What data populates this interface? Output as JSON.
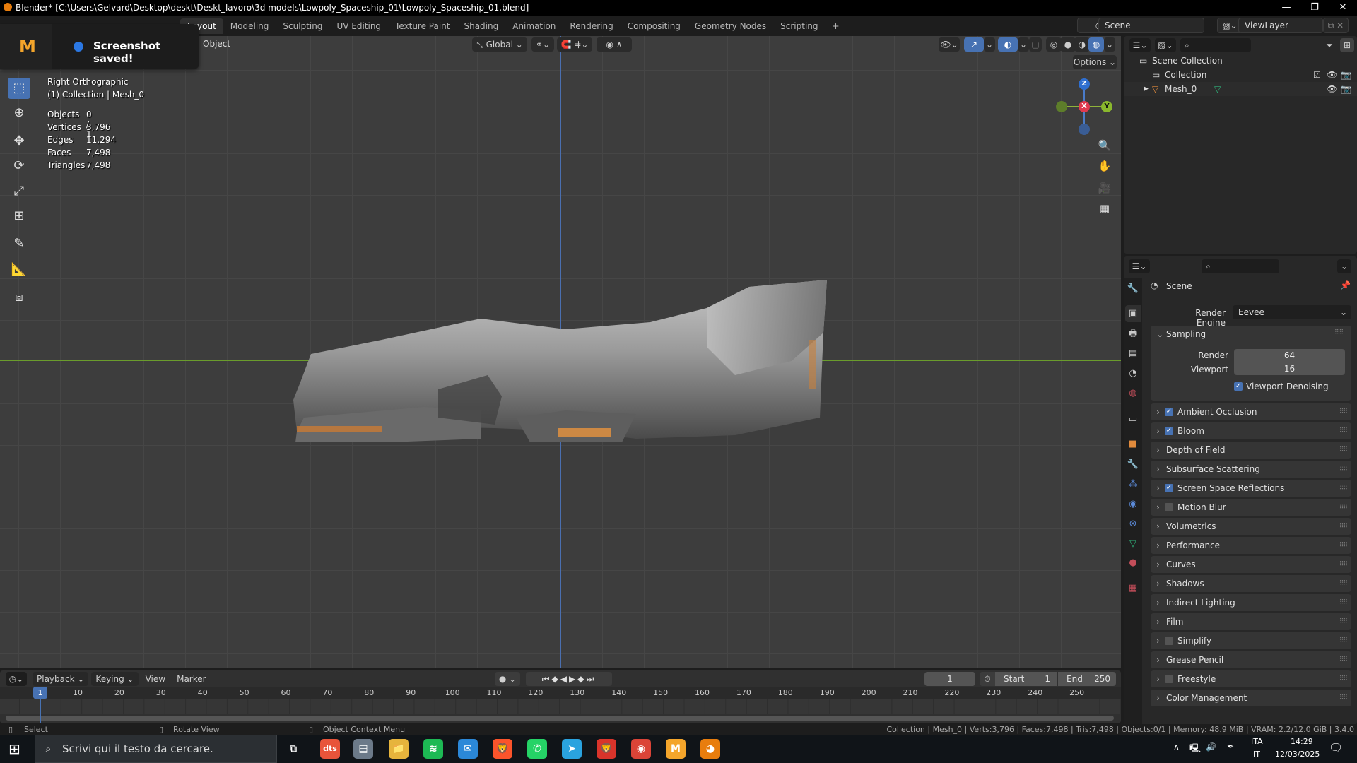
{
  "window": {
    "title": "Blender* [C:\\Users\\Gelvard\\Desktop\\deskt\\Deskt_lavoro\\3d models\\Lowpoly_Spaceship_01\\Lowpoly_Spaceship_01.blend]",
    "minimize": "—",
    "maximize": "❐",
    "close": "✕"
  },
  "workspaces": {
    "tabs": [
      "Layout",
      "Modeling",
      "Sculpting",
      "UV Editing",
      "Texture Paint",
      "Shading",
      "Animation",
      "Rendering",
      "Compositing",
      "Geometry Nodes",
      "Scripting"
    ],
    "active": "Layout",
    "add": "+"
  },
  "scene": {
    "name": "Scene",
    "view_layer": "ViewLayer"
  },
  "toast": {
    "message": "Screenshot saved!"
  },
  "viewport": {
    "menu_object": "Object",
    "orientation": "Global",
    "options": "Options ⌄",
    "view_name": "Right Orthographic",
    "context": "(1) Collection | Mesh_0",
    "stats": [
      {
        "label": "Objects",
        "value": "0 / 1"
      },
      {
        "label": "Vertices",
        "value": "3,796"
      },
      {
        "label": "Edges",
        "value": "11,294"
      },
      {
        "label": "Faces",
        "value": "7,498"
      },
      {
        "label": "Triangles",
        "value": "7,498"
      }
    ],
    "gizmo": {
      "z": "Z",
      "x": "X",
      "y": "Y"
    },
    "shading_mode": "material-preview",
    "accent": "#4772b3"
  },
  "outliner": {
    "items": [
      {
        "label": "Scene Collection",
        "icon": "collection-icon"
      },
      {
        "label": "Collection",
        "icon": "collection-icon",
        "checked": true
      },
      {
        "label": "Mesh_0",
        "icon": "mesh-object-icon"
      }
    ]
  },
  "properties": {
    "context": "Scene",
    "render_engine_label": "Render Engine",
    "render_engine": "Eevee",
    "sampling": {
      "title": "Sampling",
      "render_label": "Render",
      "render": "64",
      "viewport_label": "Viewport",
      "viewport": "16",
      "denoising_label": "Viewport Denoising",
      "denoising": true
    },
    "panels": [
      {
        "label": "Ambient Occlusion",
        "checkbox": true
      },
      {
        "label": "Bloom",
        "checkbox": true
      },
      {
        "label": "Depth of Field",
        "checkbox": null
      },
      {
        "label": "Subsurface Scattering",
        "checkbox": null
      },
      {
        "label": "Screen Space Reflections",
        "checkbox": true
      },
      {
        "label": "Motion Blur",
        "checkbox": false
      },
      {
        "label": "Volumetrics",
        "checkbox": null
      },
      {
        "label": "Performance",
        "checkbox": null
      },
      {
        "label": "Curves",
        "checkbox": null
      },
      {
        "label": "Shadows",
        "checkbox": null
      },
      {
        "label": "Indirect Lighting",
        "checkbox": null
      },
      {
        "label": "Film",
        "checkbox": null
      },
      {
        "label": "Simplify",
        "checkbox": false
      },
      {
        "label": "Grease Pencil",
        "checkbox": null
      },
      {
        "label": "Freestyle",
        "checkbox": false
      },
      {
        "label": "Color Management",
        "checkbox": null
      }
    ],
    "tabs": [
      {
        "name": "tool",
        "glyph": "🔧",
        "color": "#cccccc"
      },
      {
        "name": "render",
        "glyph": "▣",
        "color": "#cccccc",
        "active": true
      },
      {
        "name": "output",
        "glyph": "🖶",
        "color": "#cccccc"
      },
      {
        "name": "view-layer",
        "glyph": "▤",
        "color": "#cccccc"
      },
      {
        "name": "scene",
        "glyph": "◔",
        "color": "#cccccc"
      },
      {
        "name": "world",
        "glyph": "◍",
        "color": "#c44e5a"
      },
      {
        "name": "collection",
        "glyph": "▭",
        "color": "#cccccc"
      },
      {
        "name": "object",
        "glyph": "■",
        "color": "#e08a3c"
      },
      {
        "name": "modifiers",
        "glyph": "🔧",
        "color": "#5b8ad8"
      },
      {
        "name": "particles",
        "glyph": "⁂",
        "color": "#5b8ad8"
      },
      {
        "name": "physics",
        "glyph": "◉",
        "color": "#5b8ad8"
      },
      {
        "name": "constraints",
        "glyph": "⊗",
        "color": "#5b8ad8"
      },
      {
        "name": "data",
        "glyph": "▽",
        "color": "#2fb27a"
      },
      {
        "name": "material",
        "glyph": "●",
        "color": "#c44e5a"
      },
      {
        "name": "texture",
        "glyph": "▦",
        "color": "#c44e5a"
      }
    ]
  },
  "timeline": {
    "menus": [
      "Playback ⌄",
      "Keying ⌄",
      "View",
      "Marker"
    ],
    "current_frame": "1",
    "start_label": "Start",
    "start": "1",
    "end_label": "End",
    "end": "250",
    "ticks": [
      "10",
      "20",
      "30",
      "40",
      "50",
      "60",
      "70",
      "80",
      "90",
      "100",
      "110",
      "120",
      "130",
      "140",
      "150",
      "160",
      "170",
      "180",
      "190",
      "200",
      "210",
      "220",
      "230",
      "240",
      "250"
    ]
  },
  "statusbar": {
    "hints": [
      "Select",
      "Rotate View",
      "Object Context Menu"
    ],
    "info": "Collection | Mesh_0 | Verts:3,796 | Faces:7,498 | Tris:7,498 | Objects:0/1 | Memory: 48.9 MiB | VRAM: 2.2/12.0 GiB | 3.4.0"
  },
  "taskbar": {
    "search_placeholder": "Scrivi qui il testo da cercare.",
    "apps": [
      {
        "name": "task-view",
        "glyph": "⧉",
        "bg": "transparent"
      },
      {
        "name": "dts",
        "glyph": "dts",
        "bg": "#e8543a"
      },
      {
        "name": "file-manager",
        "glyph": "▤",
        "bg": "#6c7a89"
      },
      {
        "name": "explorer",
        "glyph": "📁",
        "bg": "#e6b43c"
      },
      {
        "name": "spotify",
        "glyph": "≋",
        "bg": "#1db954"
      },
      {
        "name": "mail",
        "glyph": "✉",
        "bg": "#2b88d8"
      },
      {
        "name": "brave",
        "glyph": "🦁",
        "bg": "#fb542b"
      },
      {
        "name": "whatsapp",
        "glyph": "✆",
        "bg": "#25d366"
      },
      {
        "name": "telegram",
        "glyph": "➤",
        "bg": "#2aa3df"
      },
      {
        "name": "brave-nightly",
        "glyph": "🦁",
        "bg": "#d9342b"
      },
      {
        "name": "chrome",
        "glyph": "◉",
        "bg": "#db4437"
      },
      {
        "name": "m-app",
        "glyph": "M",
        "bg": "#f4a52b"
      },
      {
        "name": "blender",
        "glyph": "◕",
        "bg": "#e87d0d"
      }
    ],
    "lang": "ITA",
    "lang2": "IT",
    "time": "14:29",
    "date": "12/03/2025"
  }
}
